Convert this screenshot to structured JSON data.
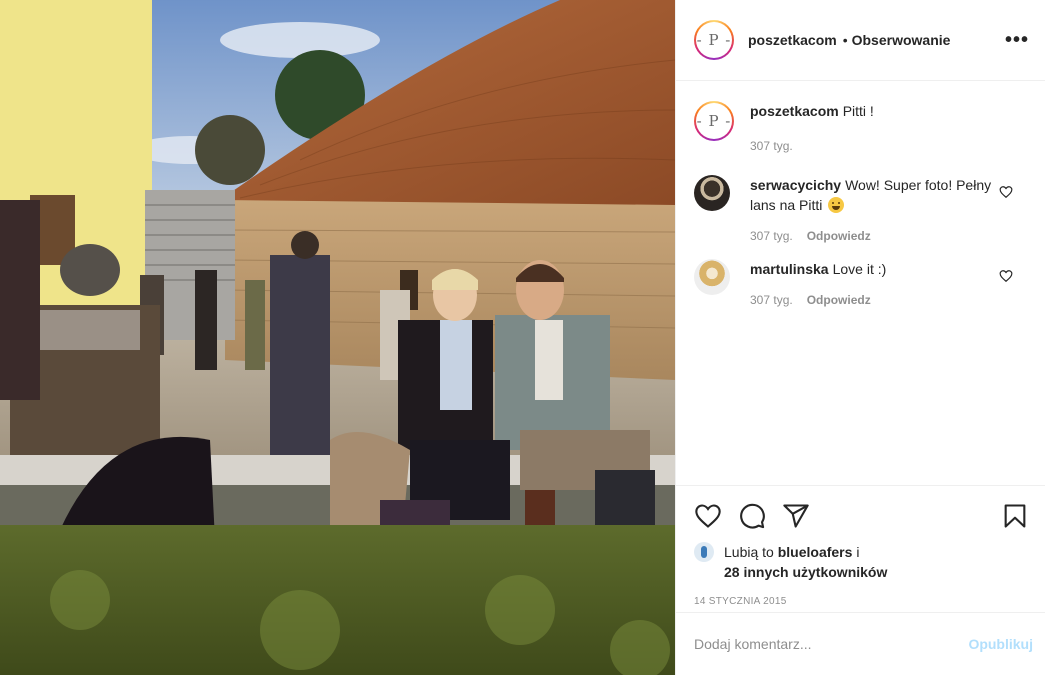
{
  "post": {
    "author": "poszetkacom",
    "avatar_letter": "- P -",
    "follow_dot": "•",
    "follow_label": "Obserwowanie",
    "more_label": "•••"
  },
  "caption": {
    "user": "poszetkacom",
    "text": "Pitti !",
    "time": "307 tyg."
  },
  "comments": [
    {
      "user": "serwacycichy",
      "text": "Wow! Super foto! Pełny lans na Pitti",
      "emoji": "grinning-face",
      "time": "307 tyg.",
      "reply_label": "Odpowiedz"
    },
    {
      "user": "martulinska",
      "text": "Love it :)",
      "time": "307 tyg.",
      "reply_label": "Odpowiedz"
    }
  ],
  "likes": {
    "prefix": "Lubią to",
    "liker": "blueloafers",
    "conjunction": "i",
    "others": "28 innych użytkowników"
  },
  "date": "14 STYCZNIA 2015",
  "comment_box": {
    "placeholder": "Dodaj komentarz...",
    "post_label": "Opublikuj"
  },
  "icons": {
    "like": "heart-icon",
    "comment": "comment-icon",
    "share": "paper-plane-icon",
    "save": "bookmark-icon"
  },
  "colors": {
    "text": "#262626",
    "muted": "#8e8e8e",
    "post_button_disabled": "#b2dffc",
    "border": "#efefef"
  }
}
